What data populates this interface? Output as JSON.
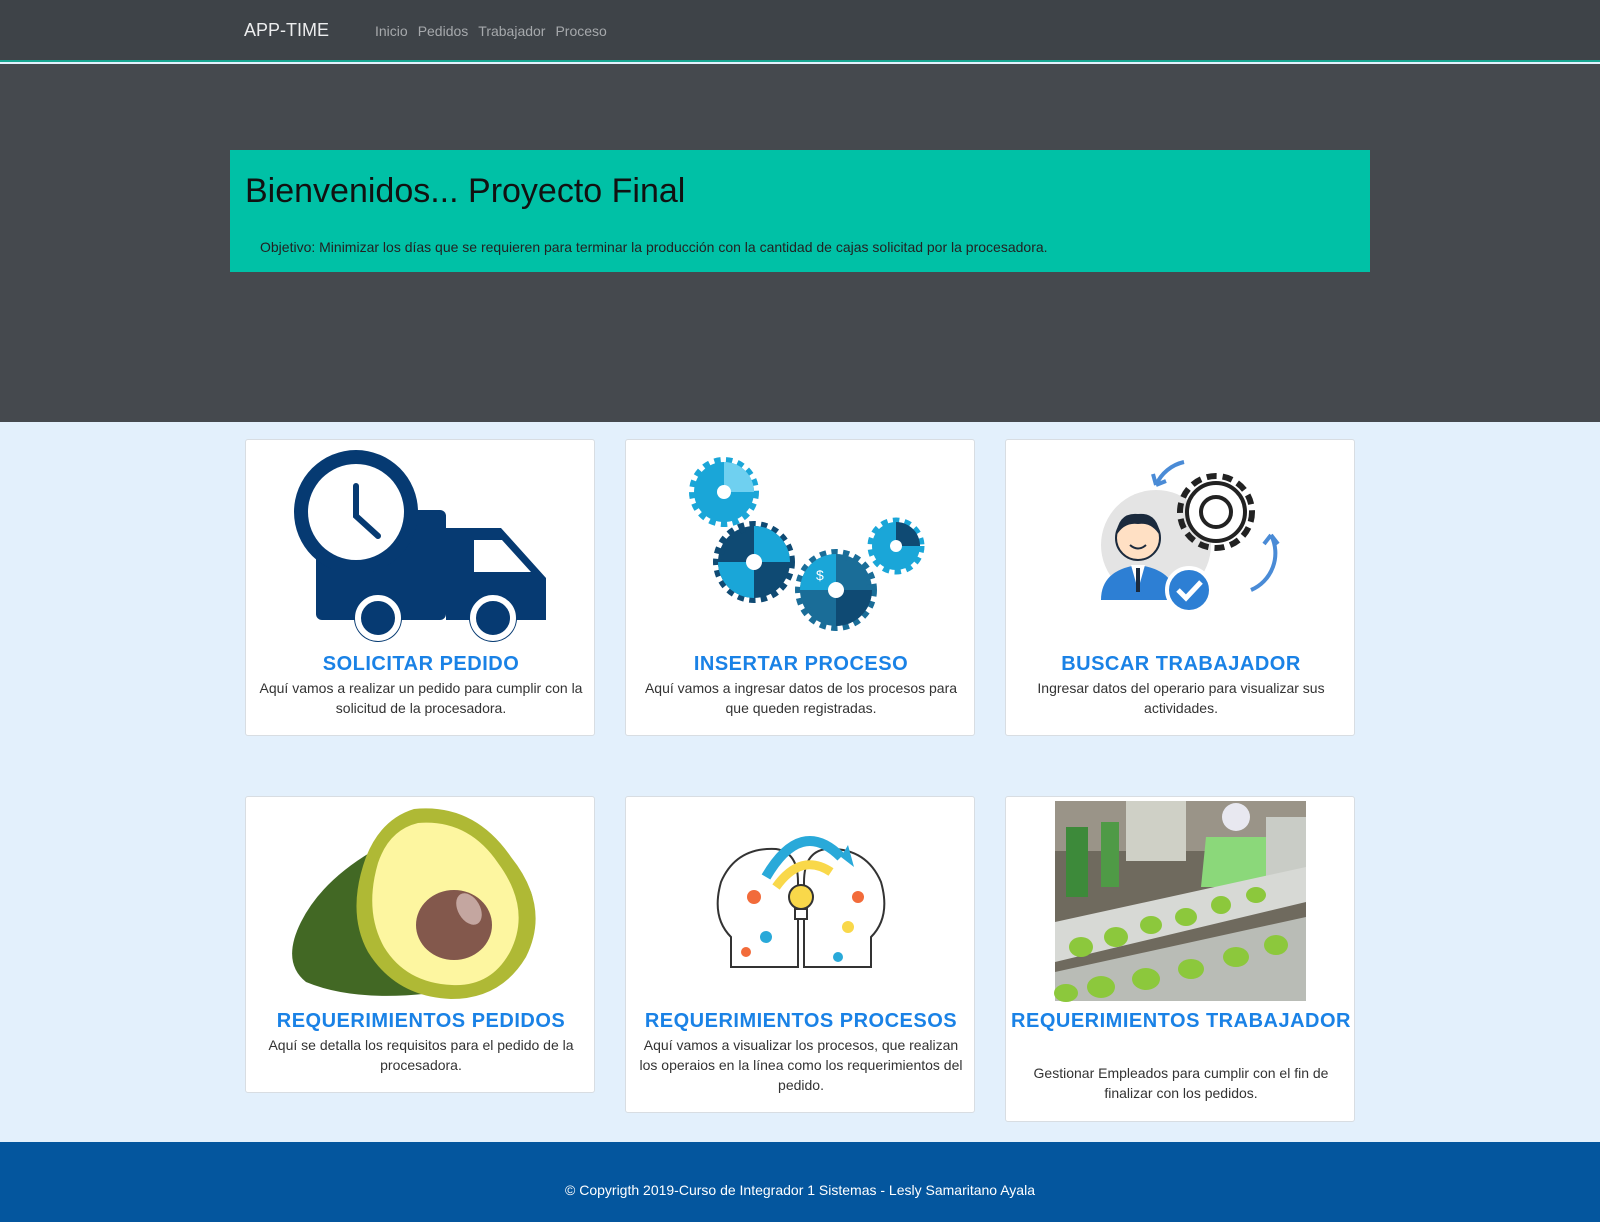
{
  "navbar": {
    "brand": "APP-TIME",
    "links": [
      "Inicio",
      "Pedidos",
      "Trabajador",
      "Proceso"
    ]
  },
  "hero": {
    "title": "Bienvenidos... Proyecto Final",
    "objective": "Objetivo: Minimizar los días que se requieren para terminar la producción con la cantidad de cajas solicitad por la procesadora."
  },
  "cards": [
    {
      "title": "SOLICITAR PEDIDO",
      "text": "Aquí vamos a realizar un pedido para cumplir con la solicitud de la procesadora.",
      "icon": "delivery-truck-clock-icon"
    },
    {
      "title": "INSERTAR PROCESO",
      "text": "Aquí vamos a ingresar datos de los procesos para que queden registradas.",
      "icon": "process-gears-icon"
    },
    {
      "title": "BUSCAR TRABAJADOR",
      "text": "Ingresar datos del operario para visualizar sus actividades.",
      "icon": "worker-gear-check-icon"
    },
    {
      "title": "REQUERIMIENTOS PEDIDOS",
      "text": "Aquí se detalla los requisitos para el pedido de la procesadora.",
      "icon": "avocado-icon"
    },
    {
      "title": "REQUERIMIENTOS PROCESOS",
      "text": "Aquí vamos a visualizar los procesos, que realizan los operaios en la línea como los requerimientos del pedido.",
      "icon": "idea-heads-icon"
    },
    {
      "title": "REQUERIMIENTOS TRABAJADOR",
      "text": "Gestionar Empleados para cumplir con el fin de finalizar con los pedidos.",
      "icon": "avocado-line-photo"
    }
  ],
  "colors": {
    "navbar": "#3e4348",
    "hero": "#45494e",
    "jumbotron": "#00c1a6",
    "card_title": "#1a82e6",
    "footer": "#04569e",
    "main_bg": "#e3f0fc"
  },
  "footer": {
    "copyright": "© Copyrigth 2019-Curso de Integrador 1 Sistemas - Lesly Samaritano Ayala"
  }
}
